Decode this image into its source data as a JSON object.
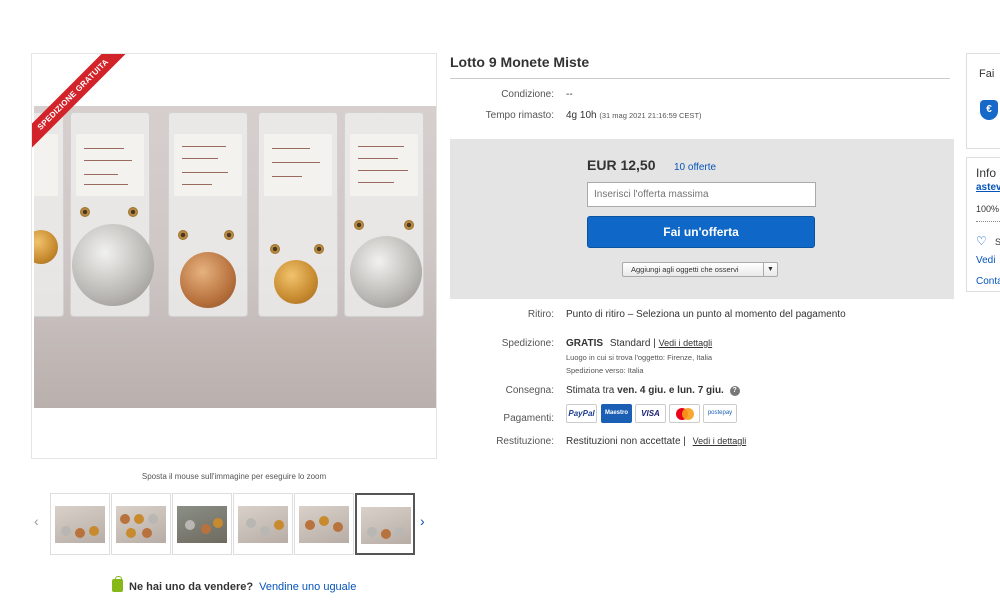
{
  "gallery": {
    "ribbon": "SPEDIZIONE GRATUITA",
    "zoom_hint": "Sposta il mouse sull'immagine per eseguire lo zoom",
    "thumbnail_count": 6,
    "active_thumbnail": 6
  },
  "sell": {
    "question": "Ne hai uno da vendere?",
    "link": "Vendine uno uguale"
  },
  "item": {
    "title": "Lotto 9 Monete Miste",
    "condition_label": "Condizione:",
    "condition_value": "--",
    "time_label": "Tempo rimasto:",
    "time_value": "4g 10h",
    "time_detail": "(31 mag 2021  21:16:59 CEST)"
  },
  "bid": {
    "price": "EUR 12,50",
    "offers": "10 offerte",
    "input_placeholder": "Inserisci l'offerta massima",
    "button": "Fai un'offerta",
    "watchlist": "Aggiungi agli oggetti che osservi"
  },
  "details": {
    "pickup_label": "Ritiro:",
    "pickup_value": "Punto di ritiro – Seleziona un punto al momento del pagamento",
    "shipping_label": "Spedizione:",
    "shipping_free": "GRATIS",
    "shipping_type": "Standard |",
    "shipping_link": "Vedi i dettagli",
    "item_location": "Luogo in cui si trova l'oggetto: Firenze, Italia",
    "ships_to": "Spedizione verso: Italia",
    "delivery_label": "Consegna:",
    "delivery_prefix": "Stimata tra",
    "delivery_range": "ven. 4 giu. e lun. 7 giu.",
    "payments_label": "Pagamenti:",
    "payment_methods": [
      "PayPal",
      "Maestro",
      "VISA",
      "MasterCard",
      "postepay"
    ],
    "returns_label": "Restituzione:",
    "returns_value": "Restituzioni non accettate |",
    "returns_link": "Vedi i dettagli"
  },
  "side": {
    "card1_title": "Fai",
    "euro_icon": "€",
    "card2_title": "Info",
    "seller": "astev",
    "feedback": "100%",
    "save": "S",
    "see": "Vedi",
    "contact": "Conta"
  },
  "colors": {
    "link": "#0654ba",
    "primary_button": "#0f67c7",
    "ribbon": "#d2232a",
    "bid_box": "#e4e4e4"
  }
}
